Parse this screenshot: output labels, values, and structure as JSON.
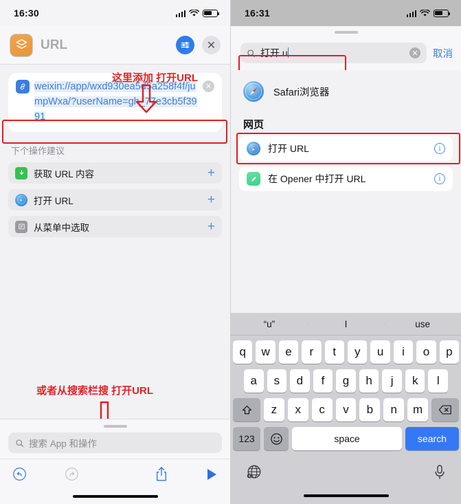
{
  "colors": {
    "accent_blue": "#3b7de0",
    "annotation_red": "#e02424",
    "highlight_border": "#e02020",
    "key_blue": "#3478f6",
    "app_icon_orange": "#e8963a",
    "green_icon": "#35c250"
  },
  "left": {
    "status": {
      "time": "16:30",
      "signal_icon": "cellular-bars-icon",
      "wifi_icon": "wifi-icon",
      "battery_icon": "battery-icon"
    },
    "header": {
      "app_icon": "shortcuts-app-icon",
      "title": "URL",
      "settings_icon": "sliders-icon",
      "close_icon": "close-x-icon"
    },
    "url_card": {
      "link_icon": "link-chip-icon",
      "value": "weixin://app/wxd930ea5d5a258f4f/jumpWxa/?userName=gh_77e3cb5f3991",
      "clear_icon": "clear-circle-icon"
    },
    "suggestions": {
      "label": "下个操作建议",
      "items": [
        {
          "icon": "download-url-icon",
          "label": "获取 URL 内容",
          "add_icon": "plus-icon"
        },
        {
          "icon": "safari-icon",
          "label": "打开 URL",
          "add_icon": "plus-icon"
        },
        {
          "icon": "menu-list-icon",
          "label": "从菜单中选取",
          "add_icon": "plus-icon"
        }
      ]
    },
    "annotations": [
      {
        "text": "这里添加 打开URL",
        "arrow": "down-arrow-icon"
      },
      {
        "text": "或者从搜索栏搜 打开URL",
        "arrow": "down-arrow-icon"
      }
    ],
    "search": {
      "icon": "search-icon",
      "placeholder": "搜索 App 和操作",
      "value": ""
    },
    "toolbar": {
      "undo_icon": "undo-icon",
      "redo_icon": "redo-icon",
      "share_icon": "share-icon",
      "play_icon": "play-icon"
    }
  },
  "right": {
    "status": {
      "time": "16:31",
      "signal_icon": "cellular-bars-icon",
      "wifi_icon": "wifi-icon",
      "battery_icon": "battery-icon"
    },
    "search": {
      "icon": "search-icon",
      "value": "打开 u",
      "clear_icon": "clear-circle-icon",
      "cancel_label": "取消"
    },
    "app_suggestion": {
      "icon": "safari-icon",
      "name": "Safari浏览器"
    },
    "group": {
      "title": "网页",
      "rows": [
        {
          "icon": "safari-icon",
          "label": "打开 URL",
          "info_icon": "info-icon",
          "highlighted": true
        },
        {
          "icon": "opener-pencil-icon",
          "label": "在 Opener 中打开 URL",
          "info_icon": "info-icon",
          "highlighted": false
        }
      ]
    },
    "keyboard": {
      "suggestions": [
        "“u”",
        "I",
        "use"
      ],
      "row1": [
        "q",
        "w",
        "e",
        "r",
        "t",
        "y",
        "u",
        "i",
        "o",
        "p"
      ],
      "row2": [
        "a",
        "s",
        "d",
        "f",
        "g",
        "h",
        "j",
        "k",
        "l"
      ],
      "row3": [
        "z",
        "x",
        "c",
        "v",
        "b",
        "n",
        "m"
      ],
      "shift_icon": "shift-arrow-icon",
      "backspace_icon": "backspace-icon",
      "numbers_label": "123",
      "emoji_icon": "emoji-smiley-icon",
      "space_label": "space",
      "return_label": "search",
      "globe_icon": "globe-icon",
      "mic_icon": "microphone-icon"
    }
  }
}
